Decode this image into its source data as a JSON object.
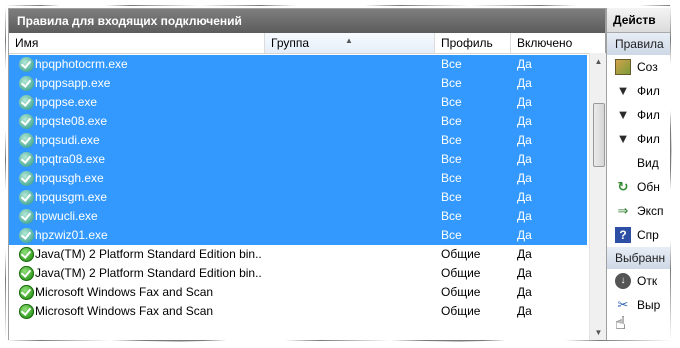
{
  "panel": {
    "title": "Правила для входящих подключений"
  },
  "columns": {
    "name": "Имя",
    "group": "Группа",
    "profile": "Профиль",
    "enabled": "Включено"
  },
  "rows": [
    {
      "name": "hpqphotocrm.exe",
      "group": "",
      "profile": "Все",
      "enabled": "Да",
      "selected": true
    },
    {
      "name": "hpqpsapp.exe",
      "group": "",
      "profile": "Все",
      "enabled": "Да",
      "selected": true
    },
    {
      "name": "hpqpse.exe",
      "group": "",
      "profile": "Все",
      "enabled": "Да",
      "selected": true
    },
    {
      "name": "hpqste08.exe",
      "group": "",
      "profile": "Все",
      "enabled": "Да",
      "selected": true
    },
    {
      "name": "hpqsudi.exe",
      "group": "",
      "profile": "Все",
      "enabled": "Да",
      "selected": true
    },
    {
      "name": "hpqtra08.exe",
      "group": "",
      "profile": "Все",
      "enabled": "Да",
      "selected": true
    },
    {
      "name": "hpqusgh.exe",
      "group": "",
      "profile": "Все",
      "enabled": "Да",
      "selected": true
    },
    {
      "name": "hpqusgm.exe",
      "group": "",
      "profile": "Все",
      "enabled": "Да",
      "selected": true
    },
    {
      "name": "hpwucli.exe",
      "group": "",
      "profile": "Все",
      "enabled": "Да",
      "selected": true
    },
    {
      "name": "hpzwiz01.exe",
      "group": "",
      "profile": "Все",
      "enabled": "Да",
      "selected": true
    },
    {
      "name": "Java(TM) 2 Platform Standard Edition bin...",
      "group": "",
      "profile": "Общие",
      "enabled": "Да",
      "selected": false
    },
    {
      "name": "Java(TM) 2 Platform Standard Edition bin...",
      "group": "",
      "profile": "Общие",
      "enabled": "Да",
      "selected": false
    },
    {
      "name": "Microsoft  Windows Fax and Scan",
      "group": "",
      "profile": "Общие",
      "enabled": "Да",
      "selected": false
    },
    {
      "name": "Microsoft  Windows Fax and Scan",
      "group": "",
      "profile": "Общие",
      "enabled": "Да",
      "selected": false
    }
  ],
  "actions": {
    "title": "Действ",
    "section_rules": "Правила",
    "items_rules": [
      {
        "label": "Соз",
        "icon": "new-rule-icon"
      },
      {
        "label": "Фил",
        "icon": "filter-icon"
      },
      {
        "label": "Фил",
        "icon": "filter-icon"
      },
      {
        "label": "Фил",
        "icon": "filter-icon"
      },
      {
        "label": "Вид",
        "icon": ""
      },
      {
        "label": "Обн",
        "icon": "refresh-icon"
      },
      {
        "label": "Эксп",
        "icon": "export-icon"
      },
      {
        "label": "Спр",
        "icon": "help-icon"
      }
    ],
    "section_selected": "Выбранн",
    "items_selected": [
      {
        "label": "Отк",
        "icon": "disable-icon"
      },
      {
        "label": "Выр",
        "icon": "cut-icon"
      }
    ]
  },
  "colors": {
    "selection": "#3399ff",
    "title_bar": "#6b6b6b"
  }
}
